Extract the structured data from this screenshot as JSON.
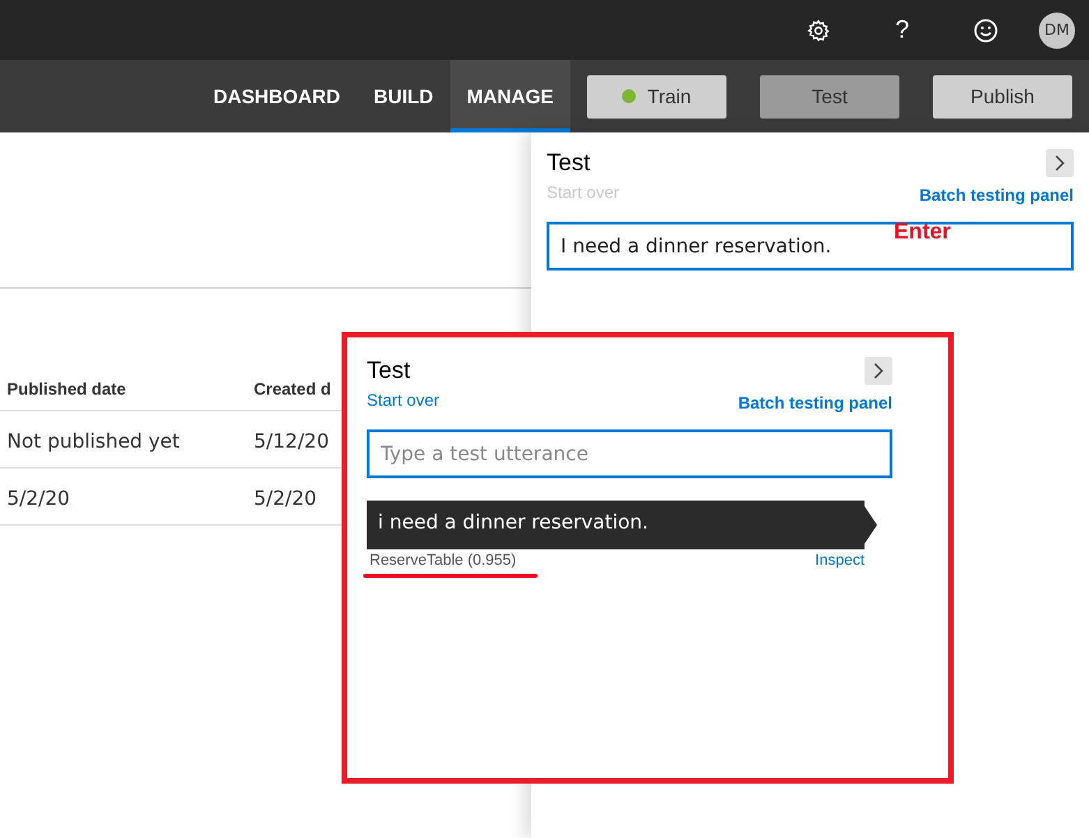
{
  "top_bar": {
    "help": "?",
    "avatar": "DM"
  },
  "nav": {
    "tabs": [
      {
        "label": "DASHBOARD",
        "selected": false
      },
      {
        "label": "BUILD",
        "selected": false
      },
      {
        "label": "MANAGE",
        "selected": true
      }
    ],
    "buttons": [
      {
        "label": "Train",
        "kind": "status",
        "color": "#7cb82f",
        "selected": false
      },
      {
        "label": "Test",
        "kind": "plain",
        "selected": true
      },
      {
        "label": "Publish",
        "kind": "plain",
        "selected": false
      }
    ]
  },
  "table": {
    "columns": [
      "Published date",
      "Created d"
    ],
    "rows": [
      [
        "Not published yet",
        "5/12/20"
      ],
      [
        "5/2/20",
        "5/2/20"
      ]
    ]
  },
  "test_panel": {
    "title": "Test",
    "start_over": {
      "label": "Start over",
      "disabled": true
    },
    "batch_link": "Batch testing panel",
    "input": {
      "value": "I need a dinner reservation."
    },
    "annotation": "Enter"
  },
  "inset_panel": {
    "title": "Test",
    "start_over": {
      "label": "Start over",
      "disabled": false
    },
    "batch_link": "Batch testing panel",
    "input": {
      "placeholder": "Type a test utterance"
    },
    "result": {
      "utterance": "i need a dinner reservation.",
      "intent": "ReserveTable (0.955)",
      "inspect": "Inspect"
    }
  }
}
